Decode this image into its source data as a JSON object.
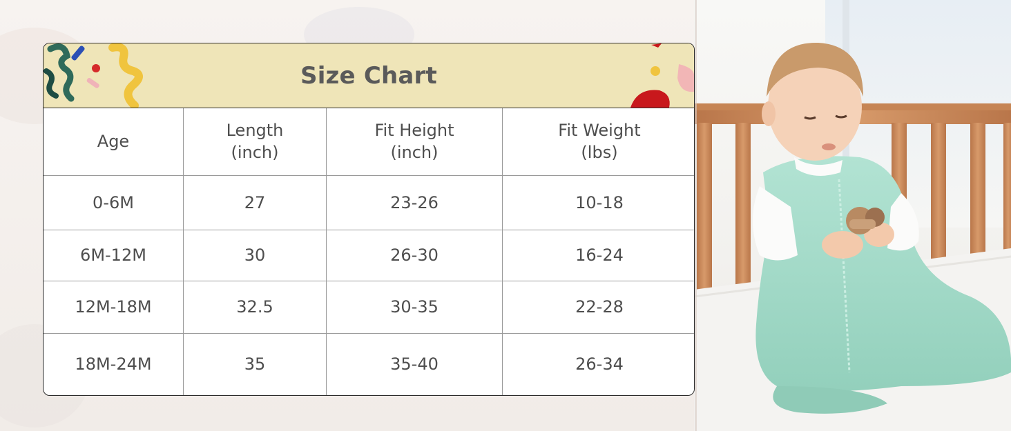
{
  "chart": {
    "title": "Size Chart",
    "headers": [
      {
        "line1": "Age",
        "line2": ""
      },
      {
        "line1": "Length",
        "line2": "(inch)"
      },
      {
        "line1": "Fit Height",
        "line2": "(inch)"
      },
      {
        "line1": "Fit Weight",
        "line2": "(lbs)"
      }
    ],
    "rows": [
      [
        "0-6M",
        "27",
        "23-26",
        "10-18"
      ],
      [
        "6M-12M",
        "30",
        "26-30",
        "16-24"
      ],
      [
        "12M-18M",
        "32.5",
        "30-35",
        "22-28"
      ],
      [
        "18M-24M",
        "35",
        "35-40",
        "26-34"
      ]
    ]
  },
  "colors": {
    "header_band": "#efe5b8",
    "text": "#4e4e4e",
    "title": "#5a5a5a",
    "sleepsack": "#9fd9c6",
    "crib_wood": "#c98a5a"
  },
  "icons": [
    "confetti-squiggle-icon",
    "baby-photo"
  ]
}
